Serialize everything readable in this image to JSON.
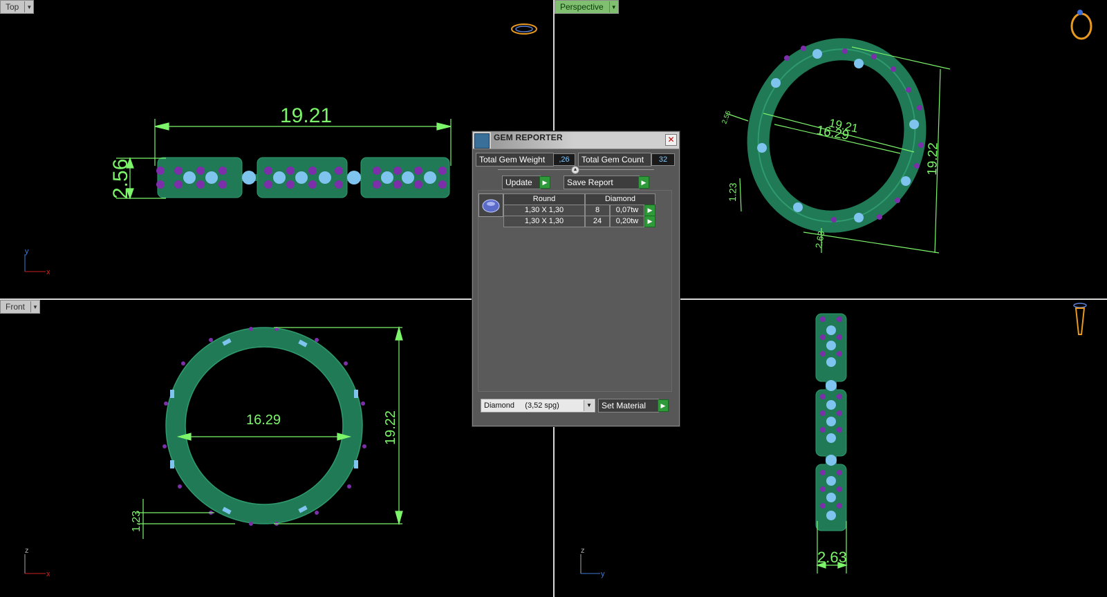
{
  "viewports": {
    "top": {
      "label": "Top",
      "dim_length": "19.21",
      "dim_height": "2.56",
      "axis_v": "y",
      "axis_h": "x"
    },
    "perspective": {
      "label": "Perspective",
      "dim_diag": "19.21",
      "dim_inner": "16.29",
      "dim_outer": "19.22",
      "dim_side": "1.23",
      "dim_bottom": "2.63",
      "dim_small": "2.56"
    },
    "front": {
      "label": "Front",
      "dim_inner": "16.29",
      "dim_outer": "19.22",
      "dim_thick": "1.23",
      "axis_v": "z",
      "axis_h": "x"
    },
    "right": {
      "dim_width": "2.63",
      "axis_v": "z",
      "axis_h": "y"
    }
  },
  "gem_reporter": {
    "title": "GEM REPORTER",
    "total_weight_label": "Total Gem Weight",
    "total_weight_value": ",26",
    "total_count_label": "Total Gem Count",
    "total_count_value": "32",
    "update_label": "Update",
    "save_report_label": "Save Report",
    "table_headers": [
      "Round",
      "Diamond"
    ],
    "rows": [
      {
        "size": "1,30 X 1,30",
        "count": "8",
        "weight": "0,07tw"
      },
      {
        "size": "1,30 X 1,30",
        "count": "24",
        "weight": "0,20tw"
      }
    ],
    "material_value": "Diamond     (3,52 spg)",
    "set_material_label": "Set Material"
  },
  "colors": {
    "metal": "#1f7a55",
    "gem_blue": "#7fc4ef",
    "gem_purple": "#7b2fa8",
    "dimension": "#7cf56a"
  },
  "icons": [
    "ring-top-icon",
    "ring-perspective-icon",
    "ring-side-icon",
    "close-icon",
    "gem-reporter-logo-icon",
    "dropdown-arrow-icon"
  ]
}
